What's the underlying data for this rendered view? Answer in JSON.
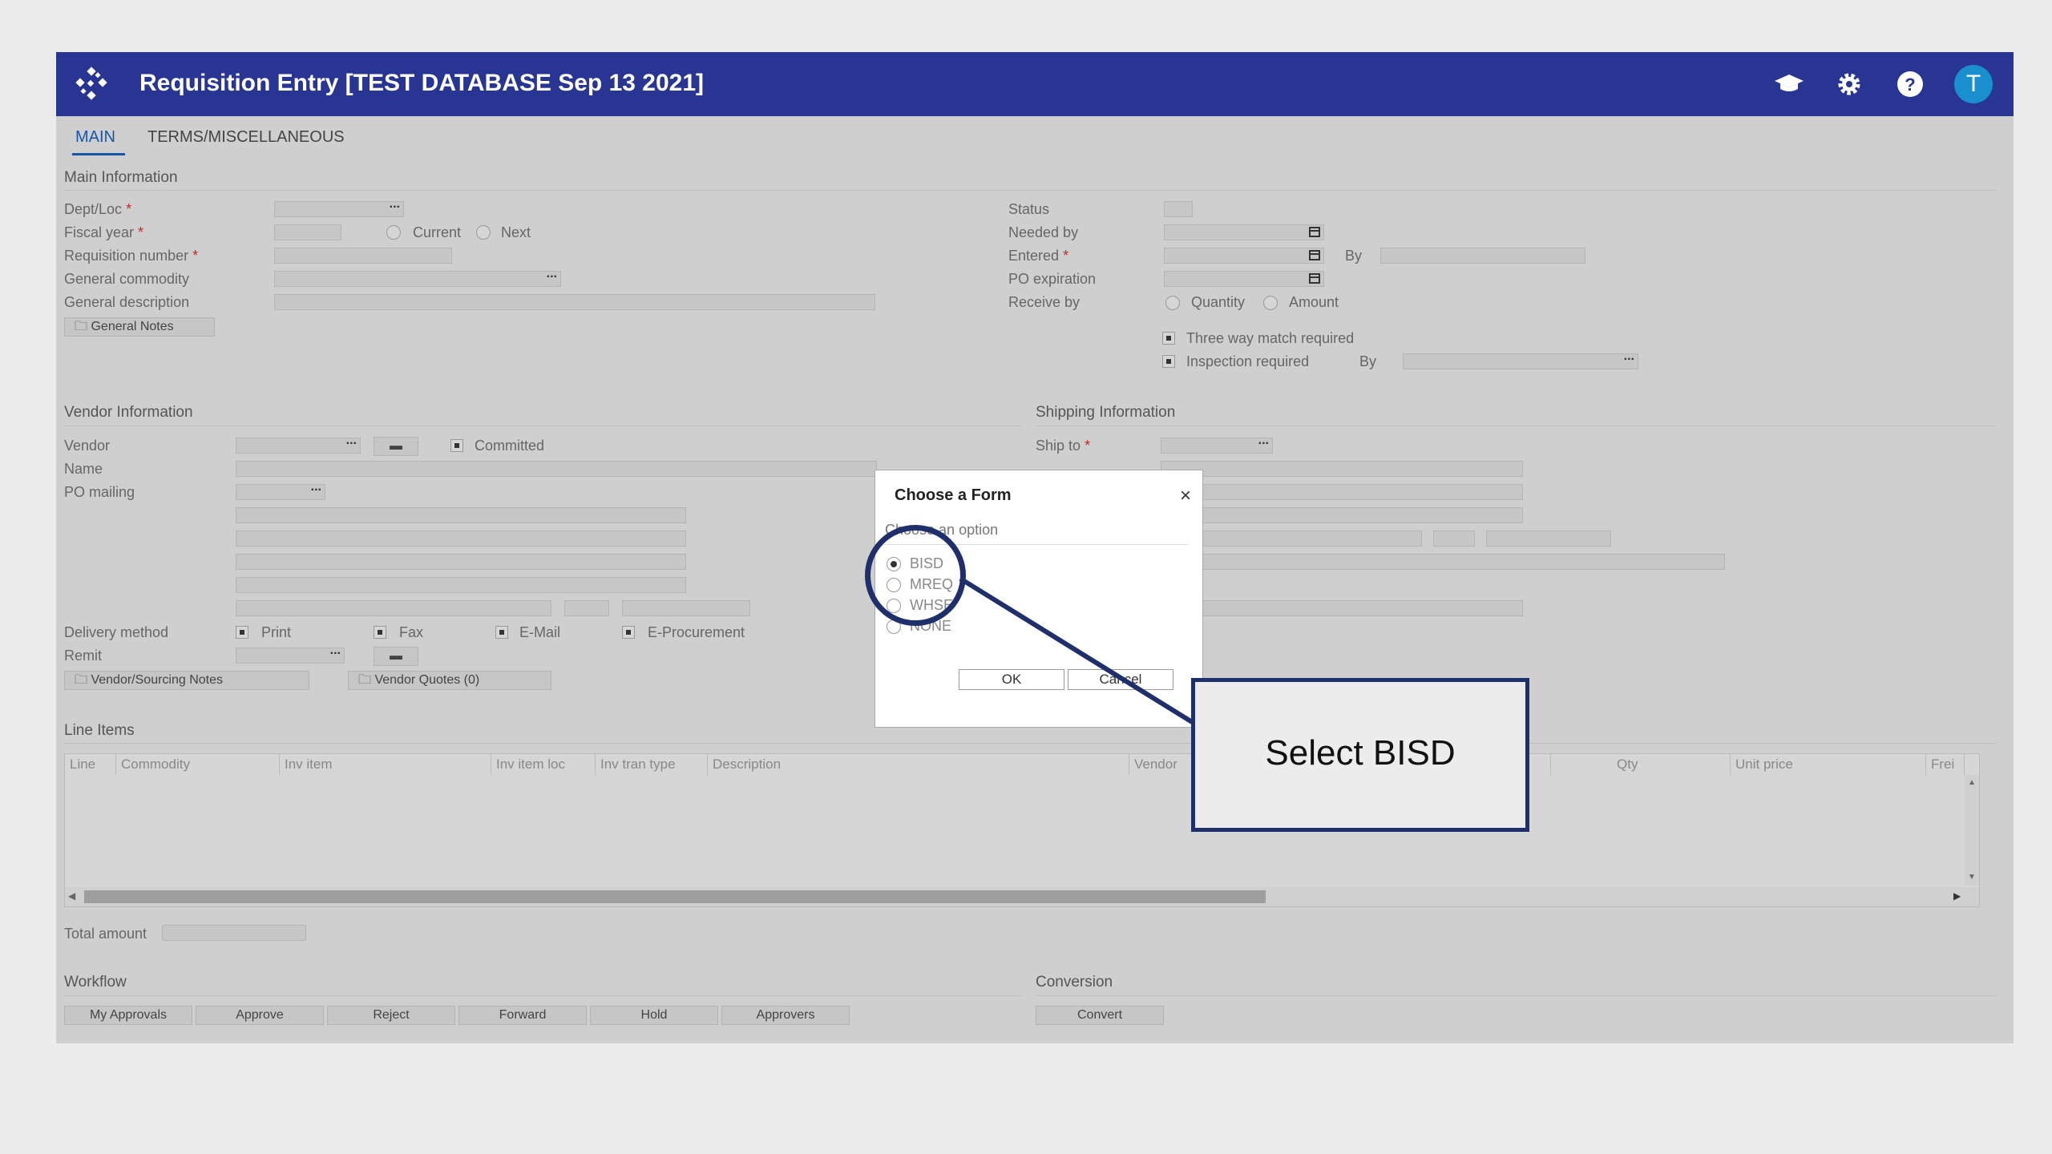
{
  "app": {
    "title": "Requisition Entry [TEST DATABASE Sep 13 2021]",
    "avatar_initial": "T",
    "colors": {
      "titlebar": "#283593",
      "accent": "#1a56a8",
      "avatar": "#1a8fcf",
      "callout_border": "#1f2f6b"
    },
    "icons": [
      "logo-icon",
      "graduation-cap-icon",
      "gear-icon",
      "help-icon"
    ]
  },
  "tabs": [
    {
      "label": "MAIN",
      "active": true
    },
    {
      "label": "TERMS/MISCELLANEOUS",
      "active": false
    }
  ],
  "main_info": {
    "section_title": "Main Information",
    "dept_loc": "Dept/Loc",
    "fiscal_year": "Fiscal year",
    "current": "Current",
    "next": "Next",
    "requisition_number": "Requisition number",
    "general_commodity": "General commodity",
    "general_description": "General description",
    "general_notes": "General Notes",
    "status": "Status",
    "needed_by": "Needed by",
    "entered": "Entered",
    "by": "By",
    "po_expiration": "PO expiration",
    "receive_by": "Receive by",
    "quantity": "Quantity",
    "amount": "Amount",
    "three_way_match": "Three way match required",
    "inspection_required": "Inspection required",
    "inspection_by": "By",
    "required_mark": "*",
    "ellipsis": "..."
  },
  "vendor_info": {
    "section_title": "Vendor Information",
    "vendor": "Vendor",
    "committed": "Committed",
    "name": "Name",
    "po_mailing": "PO mailing",
    "delivery_method": "Delivery method",
    "print": "Print",
    "fax": "Fax",
    "email": "E-Mail",
    "eprocurement": "E-Procurement",
    "remit": "Remit",
    "vendor_sourcing_notes": "Vendor/Sourcing Notes",
    "vendor_quotes": "Vendor Quotes (0)"
  },
  "shipping_info": {
    "section_title": "Shipping Information",
    "ship_to": "Ship to"
  },
  "line_items": {
    "section_title": "Line Items",
    "columns": [
      "Line",
      "Commodity",
      "Inv item",
      "Inv item loc",
      "Inv tran type",
      "Description",
      "Vendor",
      "Qty",
      "Unit price",
      "Frei"
    ]
  },
  "totals": {
    "total_amount": "Total amount"
  },
  "workflow": {
    "section_title": "Workflow",
    "buttons": [
      "My Approvals",
      "Approve",
      "Reject",
      "Forward",
      "Hold",
      "Approvers"
    ]
  },
  "conversion": {
    "section_title": "Conversion",
    "convert": "Convert"
  },
  "dialog": {
    "title": "Choose a Form",
    "subtitle": "Choose an option",
    "options": [
      {
        "label": "BISD",
        "selected": true
      },
      {
        "label": "MREQ",
        "selected": false
      },
      {
        "label": "WHSE",
        "selected": false
      },
      {
        "label": "NONE",
        "selected": false
      }
    ],
    "ok": "OK",
    "cancel": "Cancel",
    "close_glyph": "×"
  },
  "callout": {
    "text": "Select BISD"
  }
}
